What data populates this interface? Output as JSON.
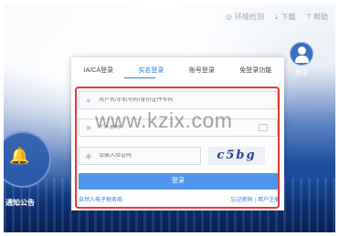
{
  "header": {
    "nav": [
      {
        "icon": "eye-icon",
        "glyph": "◎",
        "label": "环境检测"
      },
      {
        "icon": "download-icon",
        "glyph": "⤓",
        "label": "下载"
      },
      {
        "icon": "help-icon",
        "glyph": "?",
        "label": "帮助"
      }
    ],
    "user_label": "登录"
  },
  "side": {
    "notice_label": "通知公告",
    "bell_glyph": "🔔"
  },
  "login": {
    "tabs": [
      {
        "label": "IA/CA登录",
        "active": false
      },
      {
        "label": "实名登录",
        "active": true
      },
      {
        "label": "账号登录",
        "active": false
      },
      {
        "label": "免登录功能",
        "active": false
      }
    ],
    "username_placeholder": "用户名/手机号码/身份证件号码",
    "password_placeholder": "个人密码",
    "captcha_placeholder": "请输入验证码",
    "captcha_text": "c5bg",
    "login_button": "登录",
    "link_left": "自然人电子税务局",
    "link_forgot": "忘记密码",
    "link_register": "用户注册",
    "link_sep": "|"
  },
  "watermark": "www.kzix.com",
  "colors": {
    "accent": "#2d7de0",
    "button": "#4f96ec",
    "highlight_border": "#e63a2f"
  }
}
